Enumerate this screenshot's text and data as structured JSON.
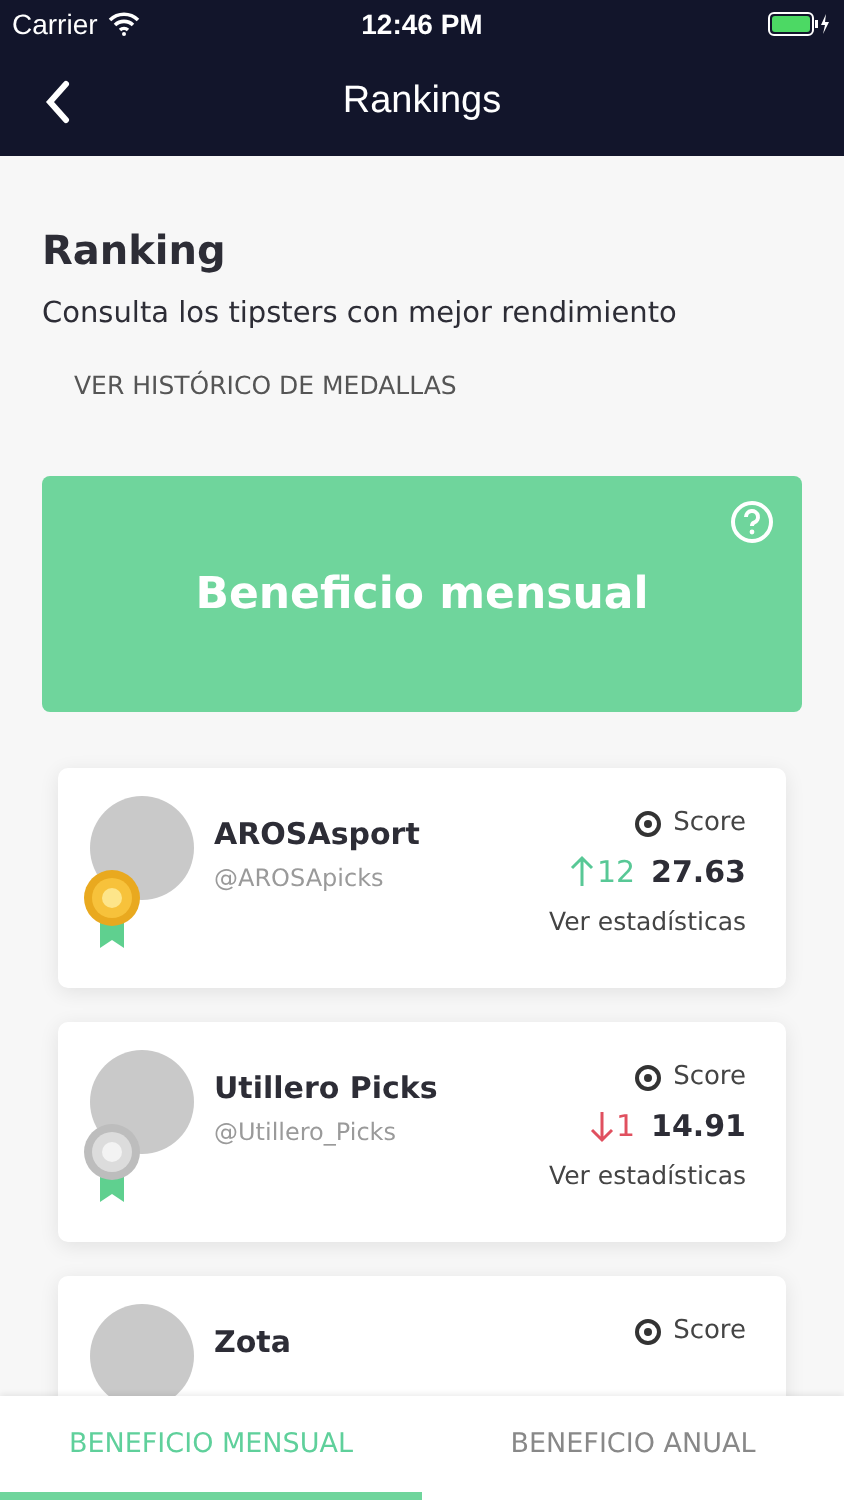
{
  "status_bar": {
    "carrier": "Carrier",
    "time": "12:46 PM"
  },
  "nav": {
    "title": "Rankings"
  },
  "header": {
    "title": "Ranking",
    "subtitle": "Consulta los tipsters con mejor rendimiento",
    "link": "VER HISTÓRICO DE MEDALLAS"
  },
  "banner": {
    "title": "Beneficio mensual"
  },
  "tipsters": [
    {
      "name": "AROSAsport",
      "handle": "@AROSApicks",
      "medal": {
        "kind": "gold"
      },
      "score_label": "Score",
      "change": {
        "kind": "up",
        "value": "12"
      },
      "score": "27.63",
      "link": "Ver estadísticas"
    },
    {
      "name": "Utillero Picks",
      "handle": "@Utillero_Picks",
      "medal": {
        "kind": "silver"
      },
      "score_label": "Score",
      "change": {
        "kind": "down",
        "value": "1"
      },
      "score": "14.91",
      "link": "Ver estadísticas"
    },
    {
      "name": "Zota",
      "score_label": "Score"
    }
  ],
  "tabs": [
    {
      "label": "BENEFICIO MENSUAL",
      "selected": true
    },
    {
      "label": "BENEFICIO ANUAL",
      "selected": false
    }
  ]
}
